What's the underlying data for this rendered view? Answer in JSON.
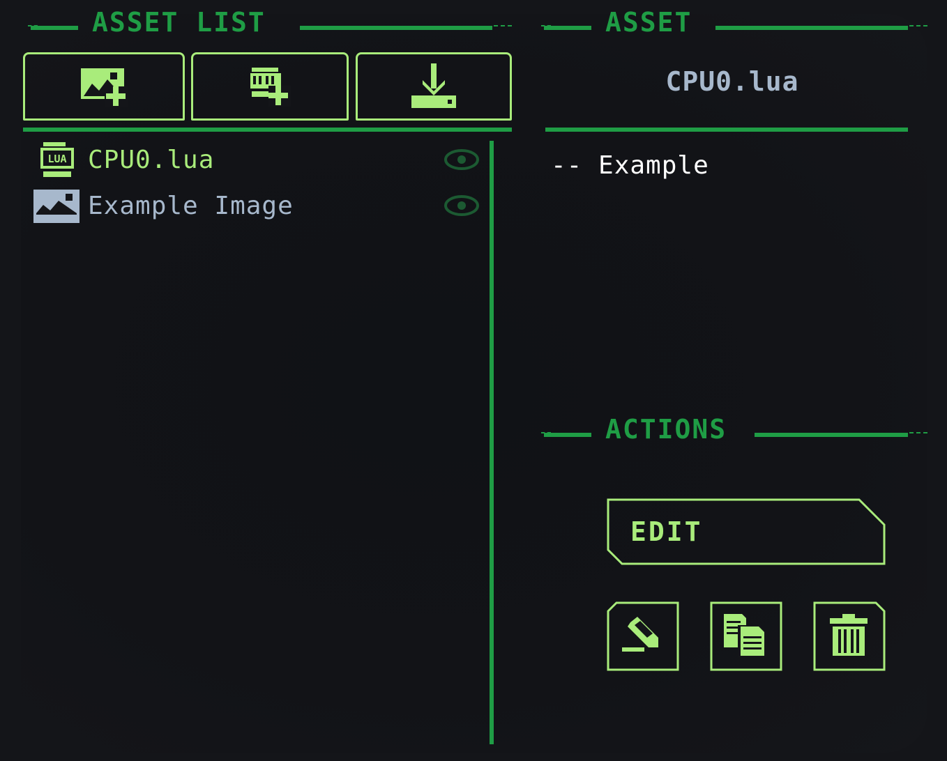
{
  "colors": {
    "background": "#141519",
    "accent_dark": "#1f9d45",
    "accent_light": "#a9ec7b",
    "muted_text": "#a7b8cc",
    "code_text": "#ffffff"
  },
  "asset_list_panel": {
    "title": "ASSET LIST",
    "toolbar": [
      {
        "name": "add-image-button",
        "icon": "image-plus-icon"
      },
      {
        "name": "add-script-button",
        "icon": "script-plus-icon"
      },
      {
        "name": "import-button",
        "icon": "download-icon"
      }
    ],
    "items": [
      {
        "label": "CPU0.lua",
        "type": "lua-script",
        "icon": "lua-file-icon",
        "selected": true,
        "visibility_icon": "eye-icon"
      },
      {
        "label": "Example Image",
        "type": "image",
        "icon": "image-file-icon",
        "selected": false,
        "visibility_icon": "eye-icon"
      }
    ]
  },
  "asset_panel": {
    "title": "ASSET",
    "asset_name": "CPU0.lua",
    "preview_text": "-- Example"
  },
  "actions_panel": {
    "title": "ACTIONS",
    "primary_button": "EDIT",
    "icon_buttons": [
      {
        "name": "rename-button",
        "icon": "pencil-icon"
      },
      {
        "name": "duplicate-button",
        "icon": "copy-icon"
      },
      {
        "name": "delete-button",
        "icon": "trash-icon"
      }
    ]
  }
}
